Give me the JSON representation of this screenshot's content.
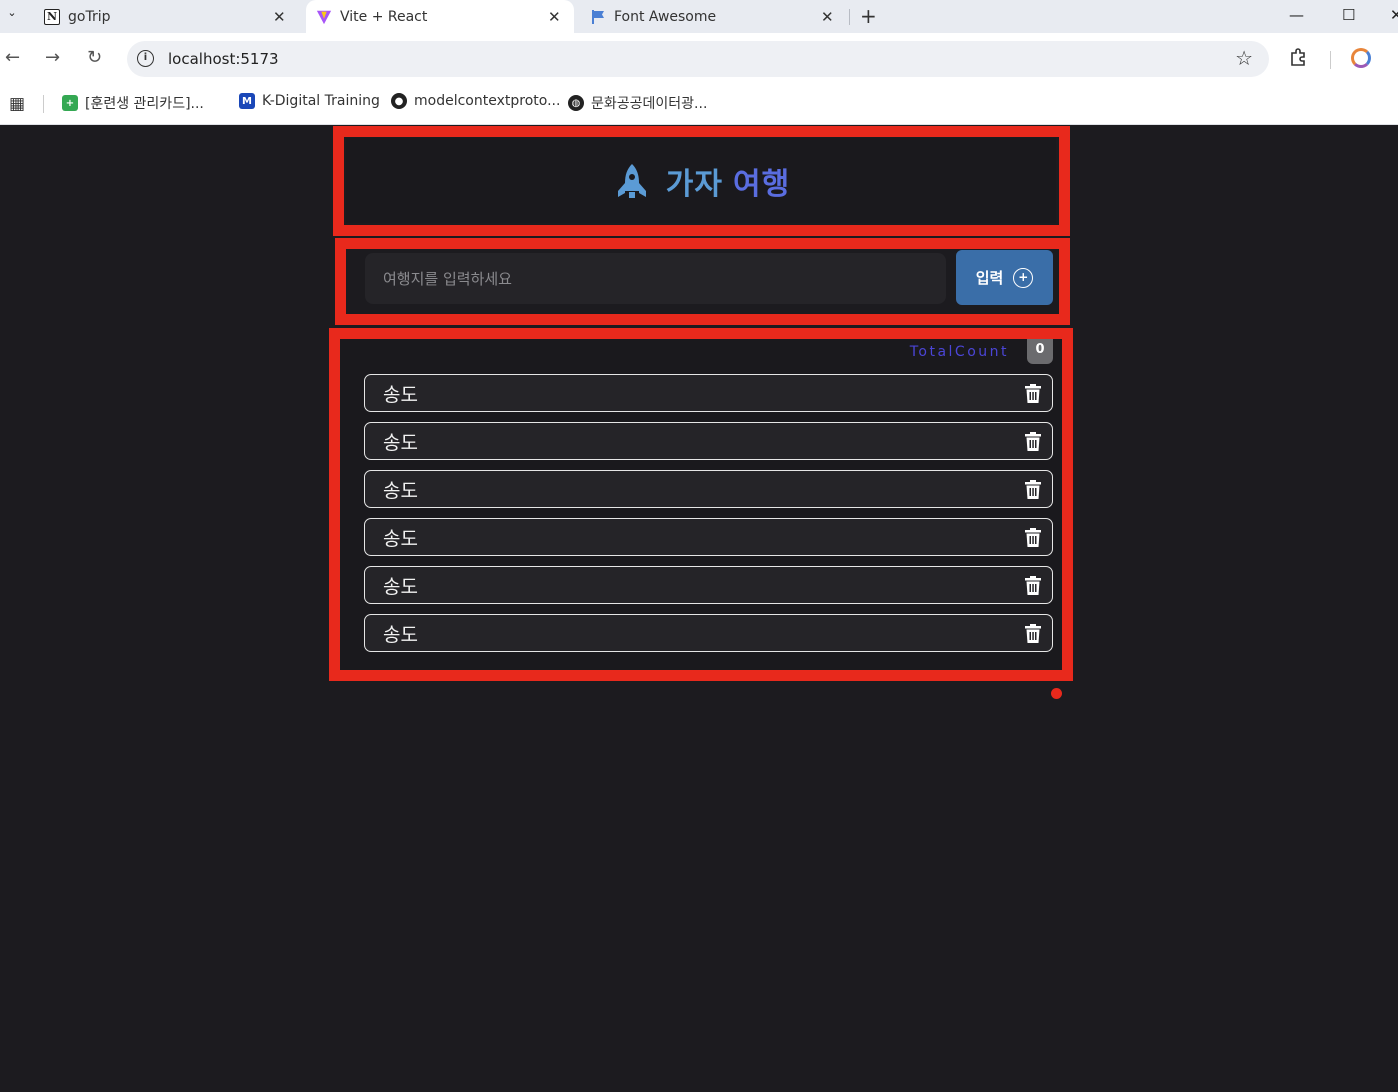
{
  "browser": {
    "tabs": [
      {
        "title": "goTrip",
        "favicon": "notion-icon",
        "active": false
      },
      {
        "title": "Vite + React",
        "favicon": "vite-icon",
        "active": true
      },
      {
        "title": "Font Awesome",
        "favicon": "flag-icon",
        "active": false
      }
    ],
    "url": "localhost:5173",
    "bookmarks": [
      {
        "label": "[훈련생 관리카드]...",
        "icon": "sheets-icon",
        "color": "#34a853"
      },
      {
        "label": "K-Digital Training",
        "icon": "m-icon",
        "color": "#1a47b8"
      },
      {
        "label": "modelcontextproto...",
        "icon": "github-icon",
        "color": "#222222"
      },
      {
        "label": "문화공공데이터광...",
        "icon": "globe-icon",
        "color": "#222222"
      }
    ]
  },
  "app": {
    "title_part1": "가자",
    "title_part2": "여행",
    "input_placeholder": "여행지를 입력하세요",
    "submit_label": "입력",
    "count_label": "TotalCount",
    "count_value": "0",
    "items": [
      {
        "name": "송도"
      },
      {
        "name": "송도"
      },
      {
        "name": "송도"
      },
      {
        "name": "송도"
      },
      {
        "name": "송도"
      },
      {
        "name": "송도"
      }
    ],
    "colors": {
      "highlight_border": "#e8291c",
      "title_primary": "#5b9bd5",
      "title_secondary": "#5a6de0",
      "button": "#3a6ea8",
      "count_label": "#4b45d6",
      "background": "#1c1b1f"
    }
  }
}
